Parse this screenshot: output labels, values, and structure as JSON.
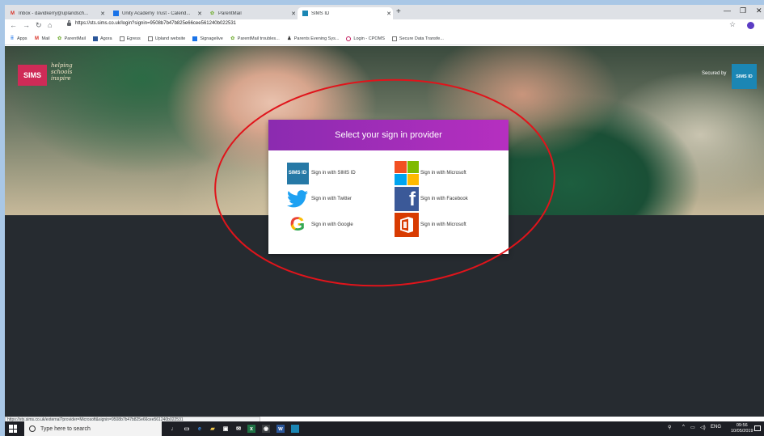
{
  "browser": {
    "tabs": [
      {
        "icon": "gmail-icon",
        "label": "Inbox - davidkerry@uplandsch..."
      },
      {
        "icon": "calendar-icon",
        "label": "Unity Academy Trust - Calend..."
      },
      {
        "icon": "parentmail-icon",
        "label": "ParentMail"
      },
      {
        "icon": "sims-icon",
        "label": "SIMS ID"
      }
    ],
    "new_tab": "+",
    "url": "https://sts.sims.co.uk/login?signin=9508b7b47b825e66cee561240b022531",
    "bookmarks": [
      "Apps",
      "Mail",
      "ParentMail",
      "Agora",
      "Egress",
      "Upland website",
      "Signagelive",
      "ParentMail troubles...",
      "Parents Evening Sys...",
      "Login - CPOMS",
      "Secure Data Transfe..."
    ]
  },
  "page": {
    "logo": "SIMS",
    "tagline": "helping\nschools\ninspire",
    "secured_by": "Secured by",
    "secured_badge": "SIMS ID",
    "modal_title": "Select your sign in provider",
    "providers": [
      {
        "label": "Sign in with SIMS ID",
        "icon": "sims-id-icon",
        "badge": "SIMS ID"
      },
      {
        "label": "Sign in with Microsoft",
        "icon": "microsoft-icon"
      },
      {
        "label": "Sign in with Twitter",
        "icon": "twitter-icon"
      },
      {
        "label": "Sign in with Facebook",
        "icon": "facebook-icon",
        "badge": "f"
      },
      {
        "label": "Sign in with Google",
        "icon": "google-icon",
        "badge": "G"
      },
      {
        "label": "Sign in with Microsoft",
        "icon": "office-icon"
      }
    ]
  },
  "status_bar": "https://sts.sims.co.uk/external?provider=Microsoft&signin=9508b7b47b825e66cee561240b022531",
  "taskbar": {
    "search_placeholder": "Type here to search",
    "language": "ENG",
    "time": "09:56",
    "date": "10/05/2019"
  },
  "colors": {
    "modal_header": "#a12eb9",
    "annotation": "#e0141b",
    "page_bg": "#262b30"
  }
}
